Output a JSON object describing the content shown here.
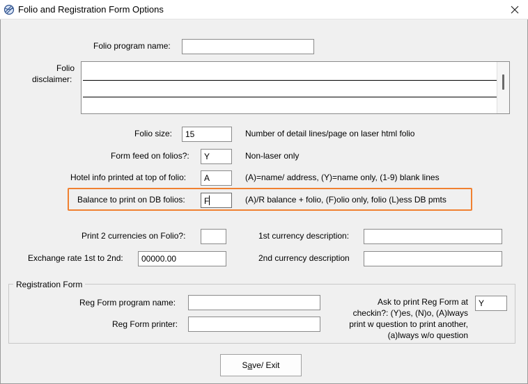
{
  "window": {
    "title": "Folio and Registration Form Options",
    "icon": "app-globe-icon",
    "close_icon": "close-icon"
  },
  "folio": {
    "program_name_label": "Folio program name:",
    "program_name_value": "",
    "disclaimer_label_1": "Folio",
    "disclaimer_label_2": "disclaimer:",
    "disclaimer_value": "",
    "size_label": "Folio size:",
    "size_value": "15",
    "size_hint": "Number of detail lines/page on laser html folio",
    "form_feed_label": "Form feed on folios?:",
    "form_feed_value": "Y",
    "form_feed_hint": "Non-laser only",
    "hotel_info_label": "Hotel info printed at top of folio:",
    "hotel_info_value": "A",
    "hotel_info_hint": "(A)=name/ address, (Y)=name only, (1-9) blank lines",
    "balance_label": "Balance to print on DB folios:",
    "balance_value": "F",
    "balance_hint": "(A)/R balance + folio, (F)olio only, folio (L)ess DB pmts",
    "two_currencies_label": "Print 2 currencies on Folio?:",
    "two_currencies_value": "",
    "exchange_label": "Exchange rate 1st to 2nd:",
    "exchange_value": "00000.00",
    "currency1_label": "1st currency description:",
    "currency1_value": "",
    "currency2_label": "2nd currency description",
    "currency2_value": ""
  },
  "registration": {
    "group_title": "Registration Form",
    "program_name_label": "Reg Form program name:",
    "program_name_value": "",
    "printer_label": "Reg Form printer:",
    "printer_value": "",
    "ask_label_1": "Ask to print Reg Form at",
    "ask_label_2": "checkin?: (Y)es, (N)o, (A)lways",
    "ask_label_3": "print w question to print another,",
    "ask_label_4": "(a)lways w/o question",
    "ask_value": "Y"
  },
  "actions": {
    "save_exit_pre": "S",
    "save_exit_underlined": "a",
    "save_exit_post": "ve/ Exit"
  },
  "colors": {
    "highlight": "#f08030",
    "background": "#f0f0f0"
  }
}
